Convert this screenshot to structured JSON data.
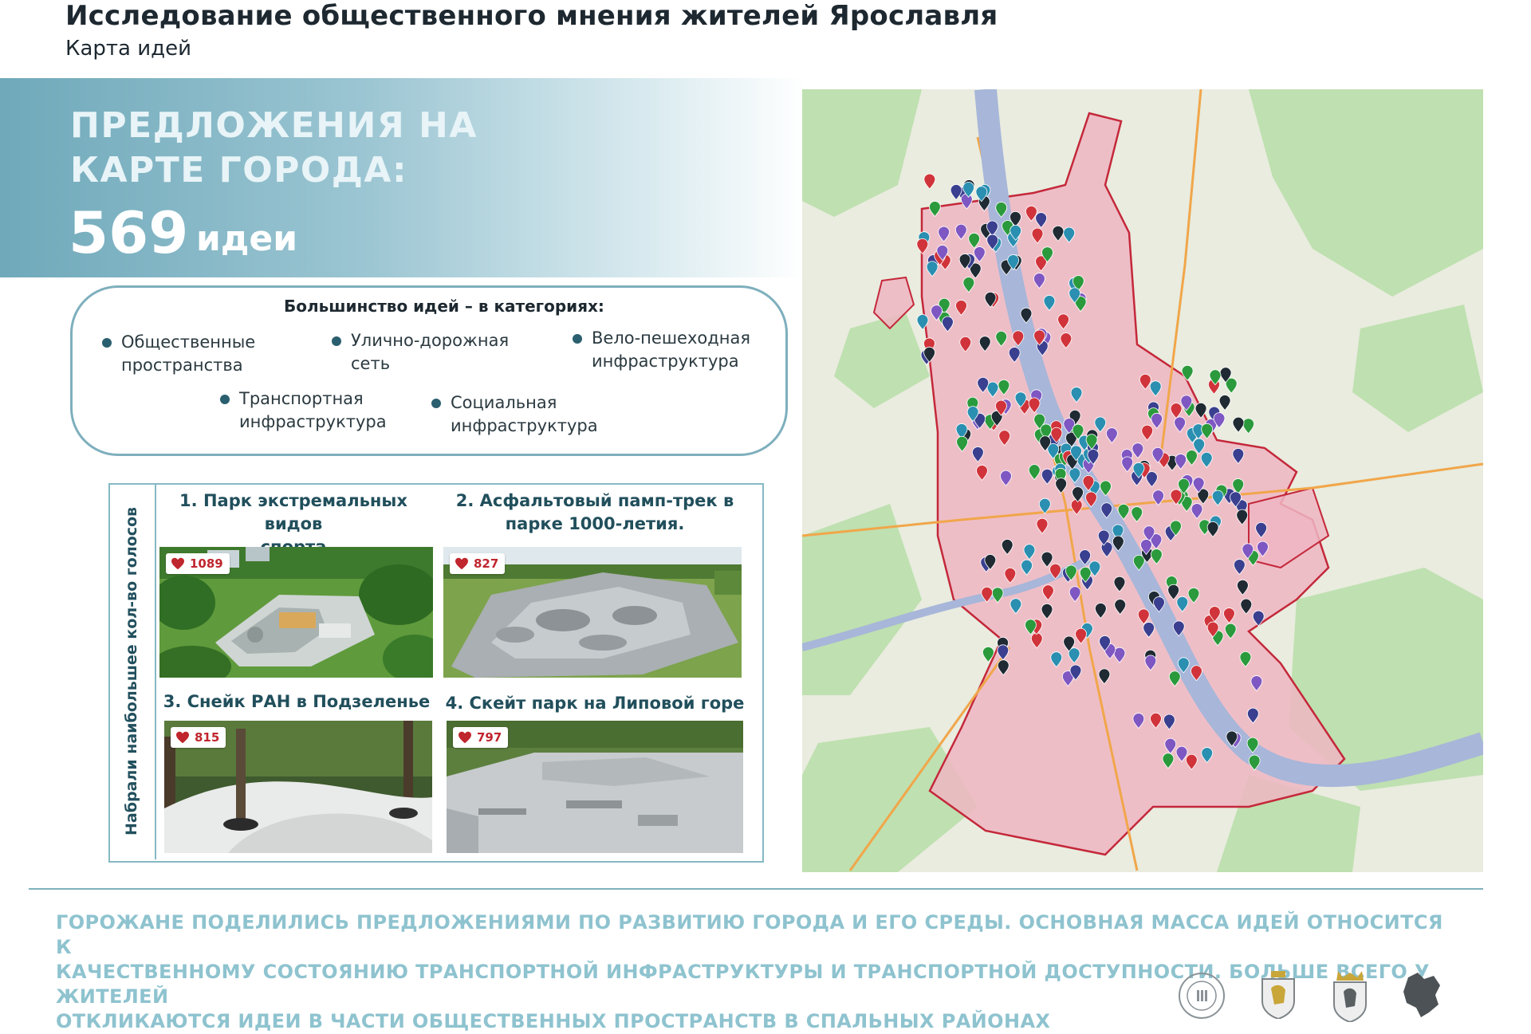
{
  "header": {
    "title": "Исследование общественного мнения жителей Ярославля",
    "subtitle": "Карта идей"
  },
  "hero": {
    "heading_line1": "ПРЕДЛОЖЕНИЯ НА",
    "heading_line2": "КАРТЕ ГОРОДА:",
    "count": "569",
    "count_label": "идеи"
  },
  "categories": {
    "title": "Большинство идей – в категориях:",
    "items": [
      {
        "line1": "Общественные",
        "line2": "пространства"
      },
      {
        "line1": "Улично-дорожная",
        "line2": "сеть"
      },
      {
        "line1": "Вело-пешеходная",
        "line2": "инфраструктура"
      },
      {
        "line1": "Транспортная",
        "line2": "инфраструктура"
      },
      {
        "line1": "Социальная",
        "line2": "инфраструктура"
      }
    ]
  },
  "top_votes": {
    "side_label": "Набрали наибольшее кол-во голосов",
    "cards": [
      {
        "title_line1": "1. Парк экстремальных видов",
        "title_line2": "спорта",
        "votes": "1089"
      },
      {
        "title_line1": "2. Асфальтовый памп-трек в",
        "title_line2": "парке 1000-летия.",
        "votes": "827"
      },
      {
        "title_line1": "3. Снейк РАН в Подзеленье",
        "title_line2": "",
        "votes": "815"
      },
      {
        "title_line1": "4. Скейт парк на Липовой горе",
        "title_line2": "",
        "votes": "797"
      }
    ]
  },
  "map": {
    "marker_colors": [
      "#2b9a3c",
      "#1f2a33",
      "#2a8fb0",
      "#d0343a",
      "#7e57c2",
      "#3a3f8f"
    ]
  },
  "footer": {
    "line1": "ГОРОЖАНЕ ПОДЕЛИЛИСЬ ПРЕДЛОЖЕНИЯМИ ПО РАЗВИТИЮ ГОРОДА И ЕГО СРЕДЫ. ОСНОВНАЯ МАССА ИДЕЙ ОТНОСИТСЯ К",
    "line2": "КАЧЕСТВЕННОМУ СОСТОЯНИЮ ТРАНСПОРТНОЙ ИНФРАСТРУКТУРЫ И ТРАНСПОРТНОЙ ДОСТУПНОСТИ. БОЛЬШЕ ВСЕГО У ЖИТЕЛЕЙ",
    "line3": "ОТКЛИКАЮТСЯ ИДЕИ В ЧАСТИ ОБЩЕСТВЕННЫХ ПРОСТРАНСТВ В СПАЛЬНЫХ РАЙОНАХ"
  },
  "logos": [
    {
      "icon": "institute-seal-icon"
    },
    {
      "icon": "coat-of-arms-bear-icon"
    },
    {
      "icon": "city-crown-arms-icon"
    },
    {
      "icon": "region-map-icon"
    }
  ]
}
